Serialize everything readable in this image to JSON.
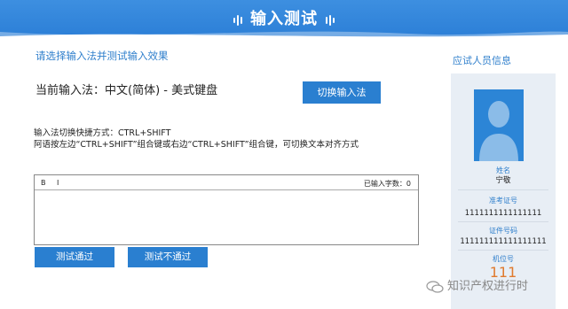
{
  "header": {
    "title": "输入测试"
  },
  "main": {
    "instruction": "请选择输入法并测试输入效果",
    "current_ime": "当前输入法：中文(简体) - 美式键盘",
    "switch_button": "切换输入法",
    "shortcut_line1": "输入法切换快捷方式：CTRL+SHIFT",
    "shortcut_line2": "阿语按左边“CTRL+SHIFT”组合键或右边“CTRL+SHIFT”组合键，可切换文本对齐方式",
    "editor": {
      "bold_label": "B",
      "italic_label": "I",
      "char_count_label": "已输入字数：0"
    },
    "pass_button": "测试通过",
    "fail_button": "测试不通过"
  },
  "sidebar": {
    "title": "应试人员信息",
    "name_label": "姓名",
    "name_value": "宁敬",
    "admission_label": "准考证号",
    "admission_value": "1111111111111111",
    "id_label": "证件号码",
    "id_value": "111111111111111111",
    "seat_label": "机位号",
    "seat_value": "111"
  },
  "watermark": {
    "text": "知识产权进行时",
    "icon": "wechat-icon"
  },
  "colors": {
    "header": "#2c7fd7",
    "button": "#2a7fd0",
    "accent_text": "#2f7fcc",
    "seat_number": "#e07a2e",
    "panel": "#e8eef5"
  }
}
